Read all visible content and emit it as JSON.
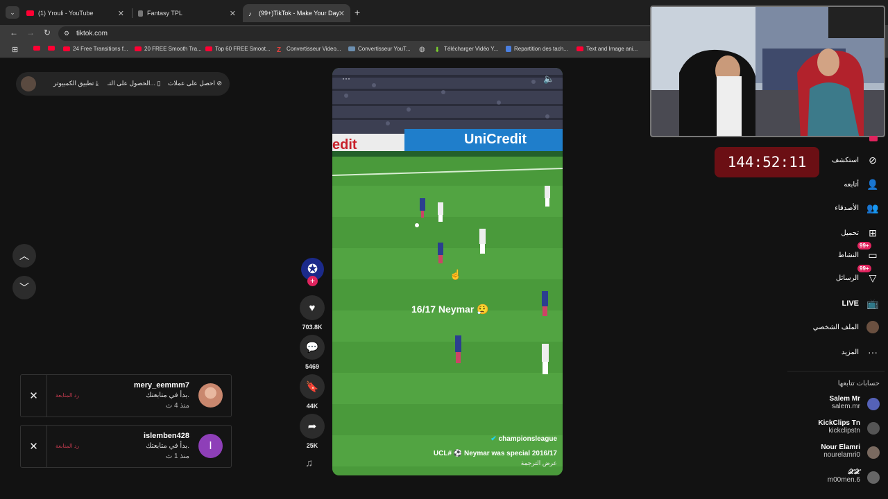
{
  "browser": {
    "tabs": [
      {
        "title": "(1) Yrouli - YouTube",
        "icon": "youtube-icon",
        "active": false
      },
      {
        "title": "Fantasy TPL",
        "icon": "page-icon",
        "active": false
      },
      {
        "title": "(99+)TikTok - Make Your Day",
        "icon": "tiktok-icon",
        "active": true
      }
    ],
    "new_tab": "+",
    "url": "tiktok.com",
    "bookmarks": [
      {
        "label": "",
        "icon": "youtube-icon"
      },
      {
        "label": "24 Free Transitions f...",
        "icon": "youtube-icon"
      },
      {
        "label": "20 FREE Smooth Tra...",
        "icon": "youtube-icon"
      },
      {
        "label": "Top 60 FREE Smoot...",
        "icon": "youtube-icon"
      },
      {
        "label": "Convertisseur Video...",
        "icon": "z-icon"
      },
      {
        "label": "Convertisseur YouT...",
        "icon": "converter-icon"
      },
      {
        "label": "",
        "icon": "globe-icon"
      },
      {
        "label": "Télécharger Vidéo Y...",
        "icon": "download-arrow-icon"
      },
      {
        "label": "Repartition des tach...",
        "icon": "doc-icon"
      },
      {
        "label": "Text and Image ani...",
        "icon": "youtube-icon"
      }
    ]
  },
  "topbar": {
    "coins": "احصل على عملات",
    "get_app": "الحصول على التـ...",
    "desktop_app": "تطبيق الكمبيوتر"
  },
  "notifications": [
    {
      "username": "mery_eemmm7",
      "message": "بدأ في متابعتك.",
      "time": "منذ 4 ث",
      "follow_back": "رد المتابعة"
    },
    {
      "username": "islemben428",
      "message": "بدأ في متابعتك.",
      "time": "منذ 1 ث",
      "follow_back": "رد المتابعة",
      "avatar_letter": "I"
    }
  ],
  "video": {
    "overlay_text": "16/17 Neymar 😮‍💨",
    "cursor": true,
    "author": "championsleague",
    "caption": "UCL# ⚽ Neymar was special 2016/17",
    "translate": "عرض الترجمة",
    "menu": "···",
    "likes": "703.8K",
    "comments": "5469",
    "saves": "44K",
    "shares": "25K",
    "ad_board_left": "edit",
    "ad_board_right": "UniCredit"
  },
  "timer": "144:52:11",
  "nav": [
    {
      "label": "استكشف",
      "icon": "compass-icon"
    },
    {
      "label": "أتابعه",
      "icon": "following-icon"
    },
    {
      "label": "الأصدقاء",
      "icon": "friends-icon"
    },
    {
      "label": "تحميل",
      "icon": "upload-icon"
    },
    {
      "label": "النشاط",
      "icon": "inbox-icon",
      "badge": "99+"
    },
    {
      "label": "الرسائل",
      "icon": "messages-icon",
      "badge": "99+"
    },
    {
      "label": "LIVE",
      "icon": "live-icon"
    },
    {
      "label": "الملف الشخصي",
      "icon": "profile-icon"
    },
    {
      "label": "المزيد",
      "icon": "more-icon"
    }
  ],
  "following_title": "حسابات تتابعها",
  "following": [
    {
      "name": "Salem Mr",
      "handle": "salem.mr"
    },
    {
      "name": "KickClips Tn",
      "handle": "kickclipstn"
    },
    {
      "name": "Nour Elamri",
      "handle": "nourelamri0"
    },
    {
      "name": "𝒳𝒳",
      "handle": "m00men.6"
    }
  ],
  "colors": {
    "accent": "#e0245e",
    "timer_bg": "#6b0f14",
    "follow_red": "#c23a4e"
  }
}
